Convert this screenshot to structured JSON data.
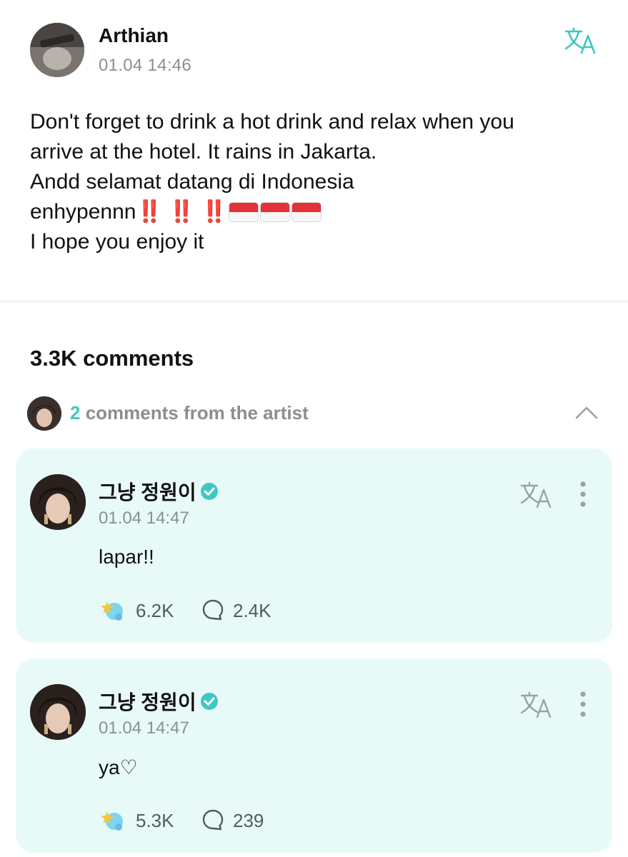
{
  "post": {
    "author": "Arthian",
    "timestamp": "01.04 14:46",
    "lines": [
      "Don't forget to drink a hot drink and relax when you",
      "arrive at the hotel. It rains in Jakarta.",
      "Andd selamat datang di Indonesia",
      "enhypennn",
      "I hope you enjoy it"
    ],
    "emoji_excl": "‼️",
    "flag_emoji": "indonesia-flag"
  },
  "comments_header": "3.3K comments",
  "artist_comments": {
    "count": "2",
    "label": " comments from the artist"
  },
  "colors": {
    "accent": "#3fc7c0",
    "card_bg": "#e8faf8",
    "muted_text": "#8a8e93"
  },
  "comments": [
    {
      "name": "그냥 정원이",
      "timestamp": "01.04 14:47",
      "text": "lapar!!",
      "likes": "6.2K",
      "replies": "2.4K"
    },
    {
      "name": "그냥 정원이",
      "timestamp": "01.04 14:47",
      "text": "ya♡",
      "likes": "5.3K",
      "replies": "239"
    }
  ]
}
